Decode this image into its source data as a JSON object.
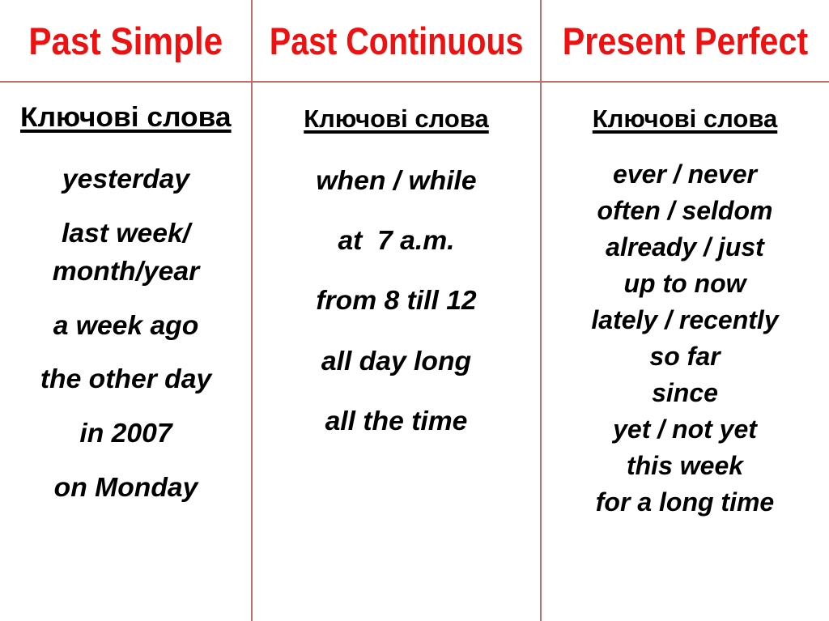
{
  "colors": {
    "header_red": "#ee1111",
    "rule_rose": "#bf6f6b",
    "text_black": "#000000",
    "background": "#ffffff"
  },
  "columns": [
    {
      "title": "Past Simple",
      "keywords_heading": "Ключові слова",
      "items": [
        "yesterday",
        "last week/\nmonth/year",
        "a week ago",
        "the other day",
        "in 2007",
        "on Monday"
      ]
    },
    {
      "title": "Past Continuous",
      "keywords_heading": "Ключові слова",
      "items": [
        "when / while",
        "at  7 a.m.",
        "from 8 till 12",
        "all day long",
        "all the time"
      ]
    },
    {
      "title": "Present Perfect",
      "keywords_heading": "Ключові слова",
      "items": [
        "ever / never",
        "often / seldom",
        "already / just",
        "up to now",
        "lately / recently",
        "so far",
        "since",
        "yet / not yet",
        "this week",
        "for a long time"
      ]
    }
  ]
}
